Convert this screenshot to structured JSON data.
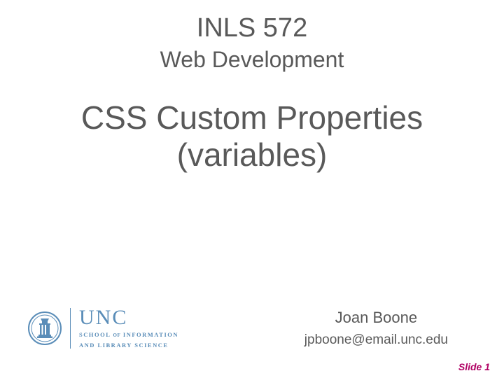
{
  "header": {
    "course_code": "INLS 572",
    "course_name": "Web Development"
  },
  "title": {
    "line1": "CSS Custom Properties",
    "line2": "(variables)"
  },
  "logo": {
    "org": "UNC",
    "dept_line1_prefix": "SCHOOL",
    "dept_line1_of": "OF",
    "dept_line1_suffix": "INFORMATION",
    "dept_line2": "AND LIBRARY SCIENCE"
  },
  "author": {
    "name": "Joan Boone",
    "email": "jpboone@email.unc.edu"
  },
  "slide_number": "Slide 1",
  "colors": {
    "text_gray": "#595959",
    "unc_blue": "#5a8db8",
    "accent_magenta": "#b00063"
  }
}
